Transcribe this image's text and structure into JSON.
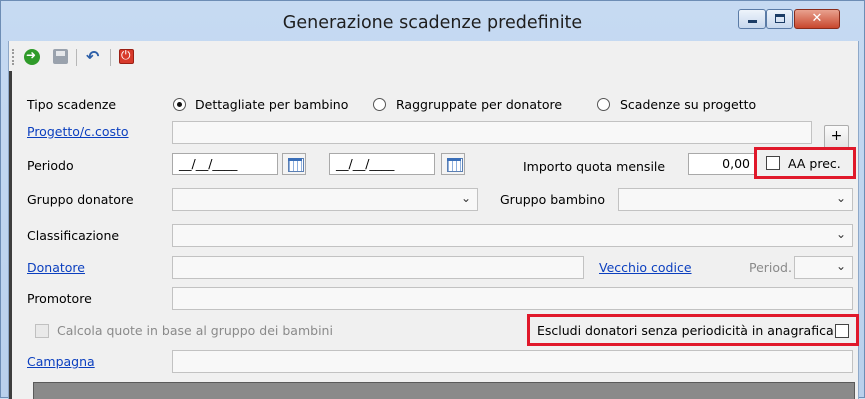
{
  "window": {
    "title": "Generazione scadenze predefinite",
    "close_glyph": "✕"
  },
  "toolbar": {
    "icons": [
      "go-arrow-icon",
      "save-icon",
      "undo-icon",
      "exit-icon"
    ]
  },
  "form": {
    "tipo_scadenze": {
      "label": "Tipo scadenze",
      "options": [
        {
          "label": "Dettagliate per bambino",
          "selected": true
        },
        {
          "label": "Raggruppate per donatore",
          "selected": false
        },
        {
          "label": "Scadenze su progetto",
          "selected": false
        }
      ]
    },
    "progetto": {
      "label": "Progetto/c.costo",
      "value": "",
      "add_label": "+"
    },
    "periodo": {
      "label": "Periodo",
      "from": "__/__/____",
      "to": "__/__/____"
    },
    "importo": {
      "label": "Importo quota mensile",
      "value": "0,00"
    },
    "aa_prec": {
      "label": "AA prec.",
      "checked": false
    },
    "gruppo_donatore": {
      "label": "Gruppo donatore",
      "value": ""
    },
    "gruppo_bambino": {
      "label": "Gruppo bambino",
      "value": ""
    },
    "classificazione": {
      "label": "Classificazione",
      "value": ""
    },
    "donatore": {
      "label": "Donatore",
      "value": ""
    },
    "vecchio_codice": {
      "label": "Vecchio codice"
    },
    "period": {
      "label": "Period.",
      "value": ""
    },
    "promotore": {
      "label": "Promotore",
      "value": ""
    },
    "calcola": {
      "label": "Calcola quote in base al gruppo dei bambini",
      "checked": false
    },
    "escludi": {
      "label": "Escludi donatori senza periodicità in anagrafica",
      "checked": false
    },
    "campagna": {
      "label": "Campagna",
      "value": ""
    }
  },
  "colors": {
    "highlight": "#e0182a",
    "link": "#0b3fbf"
  }
}
